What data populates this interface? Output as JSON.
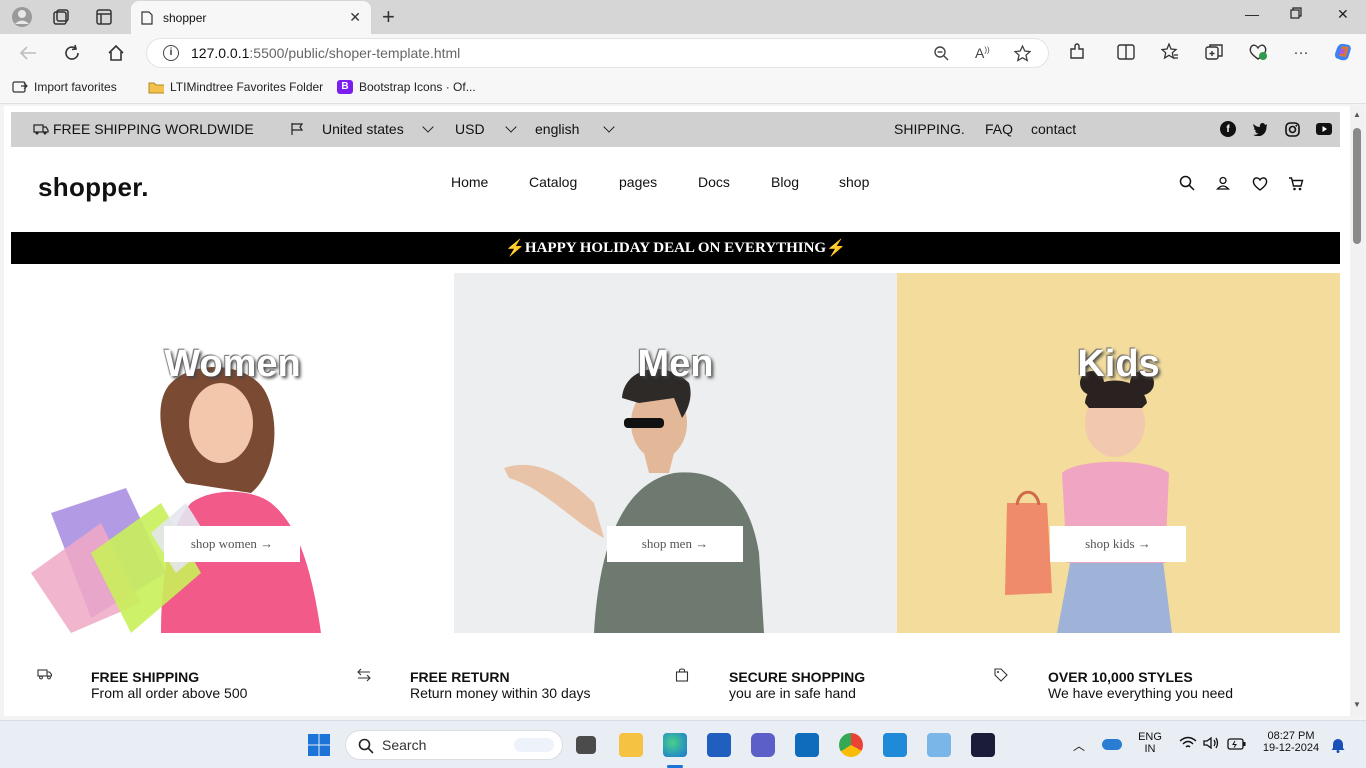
{
  "browser": {
    "tab_title": "shopper",
    "url_host": "127.0.0.1",
    "url_rest": ":5500/public/shoper-template.html",
    "favorites": [
      {
        "label": "Import favorites"
      },
      {
        "label": "LTIMindtree Favorites Folder"
      },
      {
        "label": "Bootstrap Icons · Of..."
      }
    ]
  },
  "topbar": {
    "shipping_text": "FREE SHIPPING WORLDWIDE",
    "country": "United states",
    "currency": "USD",
    "language": "english",
    "links": [
      "SHIPPING.",
      "FAQ",
      "contact"
    ]
  },
  "header": {
    "logo": "shopper.",
    "nav": [
      "Home",
      "Catalog",
      "pages",
      "Docs",
      "Blog",
      "shop"
    ]
  },
  "promo": {
    "text": "HAPPY HOLIDAY DEAL ON EVERYTHING",
    "bolt": "⚡"
  },
  "categories": [
    {
      "title": "Women",
      "button": "shop women →"
    },
    {
      "title": "Men",
      "button": "shop men →"
    },
    {
      "title": "Kids",
      "button": "shop kids →"
    }
  ],
  "features": [
    {
      "title": "FREE SHIPPING",
      "subtitle": "From all order above 500"
    },
    {
      "title": "FREE RETURN",
      "subtitle": "Return money within 30 days"
    },
    {
      "title": "SECURE SHOPPING",
      "subtitle": "you are in safe hand"
    },
    {
      "title": "OVER 10,000 STYLES",
      "subtitle": "We have everything you need"
    }
  ],
  "taskbar": {
    "search_placeholder": "Search",
    "lang_line1": "ENG",
    "lang_line2": "IN",
    "time": "08:27 PM",
    "date": "19-12-2024"
  },
  "colors": {
    "topstrip": "#d0d0d0",
    "promo_bg": "#000000",
    "bolt": "#f7c600",
    "kids_bg": "#f3dc9c",
    "men_bg": "#eceeef"
  }
}
